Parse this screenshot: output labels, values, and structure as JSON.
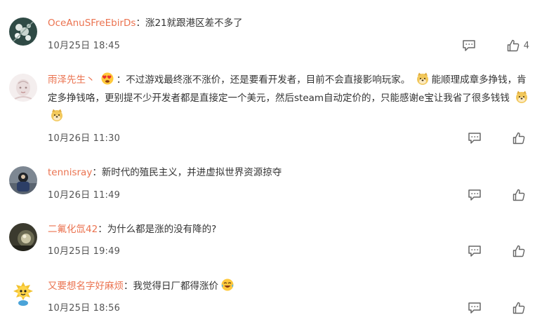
{
  "comments": [
    {
      "username": "OceAnuSFreEbirDs",
      "colon": "：",
      "text": "涨21就跟港区差不多了",
      "timestamp": "10月25日 18:45",
      "like_count": "4"
    },
    {
      "username": "雨泽先生丶",
      "colon": "：",
      "text_before_emoji": "不过游戏最终涨不涨价，还是要看开发者，目前不会直接影响玩家。",
      "text_after_emoji": "能顺理成章多挣钱，肯定多挣钱咯，更别提不少开发者都是直接定一个美元，然后steam自动定价的，只能感谢e宝让我省了很多钱钱",
      "timestamp": "10月26日 11:30",
      "like_count": ""
    },
    {
      "username": "tennisray",
      "colon": "：",
      "text": "新时代的殖民主义，并进虚拟世界资源掠夺",
      "timestamp": "10月26日 11:49",
      "like_count": ""
    },
    {
      "username": "二氟化氙42",
      "colon": "：",
      "text": "为什么都是涨的没有降的?",
      "timestamp": "10月25日 19:49",
      "like_count": ""
    },
    {
      "username": "又要想名字好麻烦",
      "colon": "：",
      "text": "我觉得日厂都得涨价",
      "timestamp": "10月25日 18:56",
      "like_count": ""
    }
  ],
  "icons": {
    "reply": "reply-icon",
    "like": "thumbs-up-icon",
    "emoji_heart": "heart-eyes-emoji-icon",
    "emoji_doge": "doge-emoji-icon",
    "emoji_laugh": "laugh-cry-emoji-icon"
  },
  "colors": {
    "username": "#eb7350",
    "text": "#333333",
    "meta": "#555555"
  }
}
